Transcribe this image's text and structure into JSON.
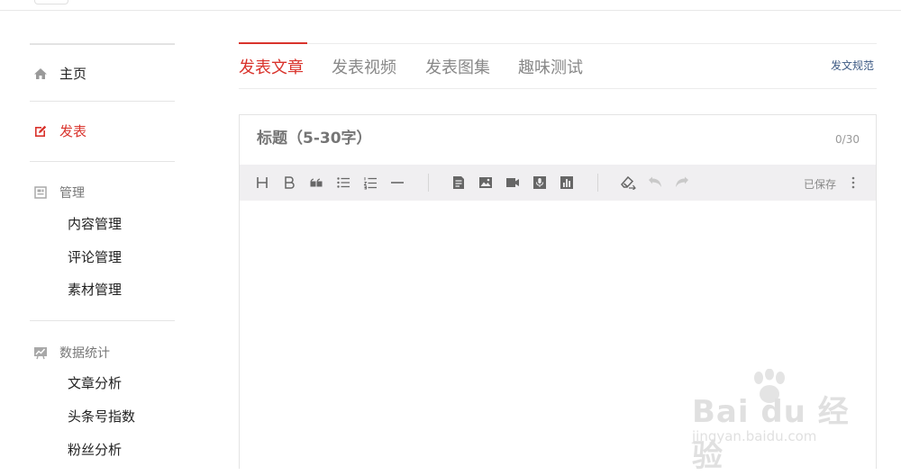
{
  "sidebar": {
    "home": {
      "label": "主页",
      "icon": "home-icon"
    },
    "publish": {
      "label": "发表",
      "icon": "edit-icon"
    },
    "manage": {
      "label": "管理",
      "icon": "manage-icon",
      "items": [
        "内容管理",
        "评论管理",
        "素材管理"
      ]
    },
    "stats": {
      "label": "数据统计",
      "icon": "stats-icon",
      "items": [
        "文章分析",
        "头条号指数",
        "粉丝分析"
      ]
    }
  },
  "tabs": [
    {
      "label": "发表文章",
      "active": true
    },
    {
      "label": "发表视频",
      "active": false
    },
    {
      "label": "发表图集",
      "active": false
    },
    {
      "label": "趣味测试",
      "active": false
    }
  ],
  "rules_link": "发文规范",
  "editor": {
    "title_placeholder": "标题（5-30字）",
    "title_count": "0/30",
    "saved_text": "已保存",
    "toolbar_icons": [
      "heading-icon",
      "bold-icon",
      "quote-icon",
      "bullet-list-icon",
      "numbered-list-icon",
      "divider-icon",
      "document-icon",
      "image-icon",
      "video-icon",
      "audio-icon",
      "chart-icon",
      "eraser-icon",
      "undo-icon",
      "redo-icon",
      "more-icon"
    ]
  },
  "colors": {
    "accent": "#d9332c",
    "link": "#3d5a84",
    "toolbar_bg": "#f0eff1"
  },
  "watermark": {
    "main": "Bai du 经验",
    "sub": "jingyan.baidu.com"
  }
}
